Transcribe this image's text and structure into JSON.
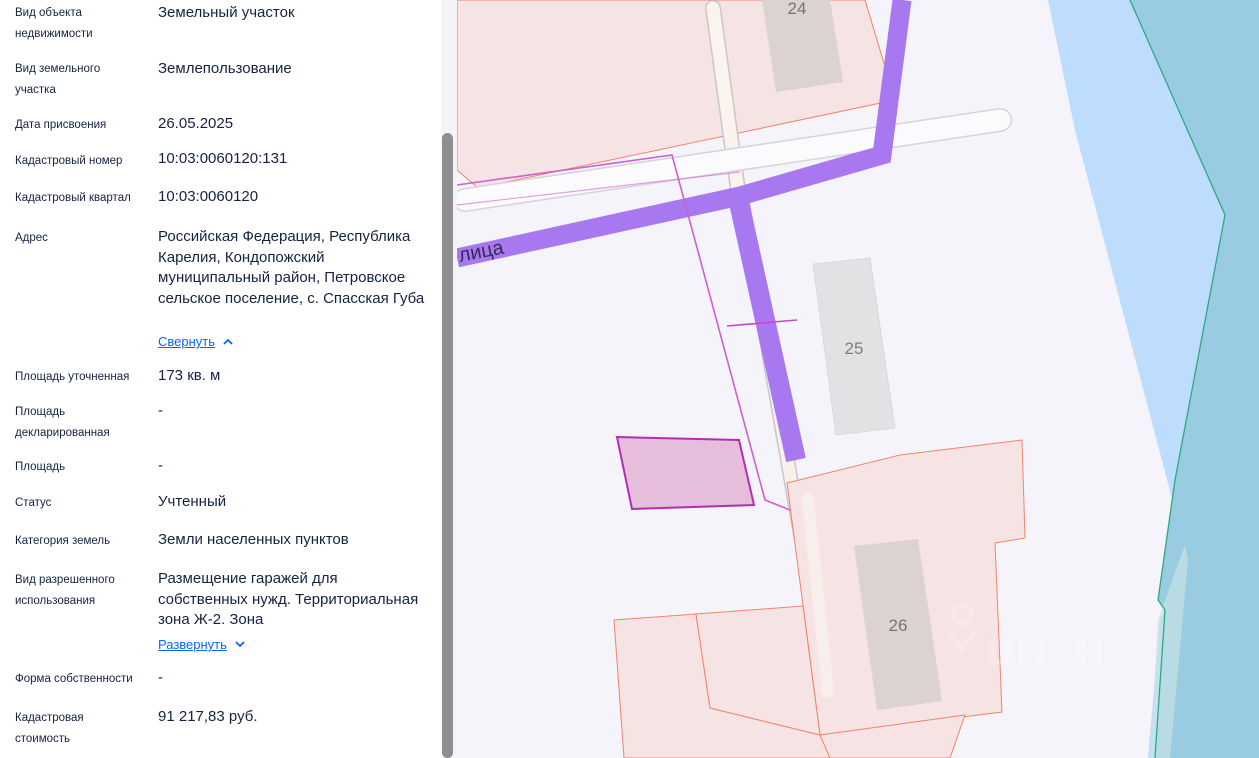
{
  "details": [
    {
      "label": "Вид объекта недвижимости",
      "value": "Земельный участок"
    },
    {
      "label": "Вид земельного участка",
      "value": "Землепользование"
    },
    {
      "label": "Дата присвоения",
      "value": "26.05.2025"
    },
    {
      "label": "Кадастровый номер",
      "value": "10:03:0060120:131"
    },
    {
      "label": "Кадастровый квартал",
      "value": "10:03:0060120"
    },
    {
      "label": "Адрес",
      "value": "Российская Федерация, Республика Карелия, Кондопожский муниципальный район, Петровское сельское поселение, с. Спасская Губа",
      "toggle": "Свернуть"
    },
    {
      "label": "Площадь уточненная",
      "value": "173 кв. м"
    },
    {
      "label": "Площадь декларированная",
      "value": "-"
    },
    {
      "label": "Площадь",
      "value": "-"
    },
    {
      "label": "Статус",
      "value": "Учтенный"
    },
    {
      "label": "Категория земель",
      "value": "Земли населенных пунктов"
    },
    {
      "label": "Вид разрешенного использования",
      "value": "Размещение гаражей для собственных нужд. Территориальная зона Ж-2. Зона",
      "toggle": "Развернуть"
    },
    {
      "label": "Форма собственности",
      "value": "-"
    },
    {
      "label": "Кадастровая стоимость",
      "value": "91 217,83 руб."
    }
  ],
  "map": {
    "street_label": "лица",
    "buildings": [
      "24",
      "25",
      "26"
    ],
    "watermark": "циан",
    "colors": {
      "background": "#f4f4fa",
      "water": "#99cce1",
      "water_light": "#bedcfb",
      "parcel_fill": "#f6e3e3",
      "parcel_stroke": "#f0846c",
      "building_fill": "#dcd2d2",
      "road": "#a778f0",
      "selected_parcel": "#e6bedc",
      "selected_stroke": "#b42eb4"
    }
  }
}
